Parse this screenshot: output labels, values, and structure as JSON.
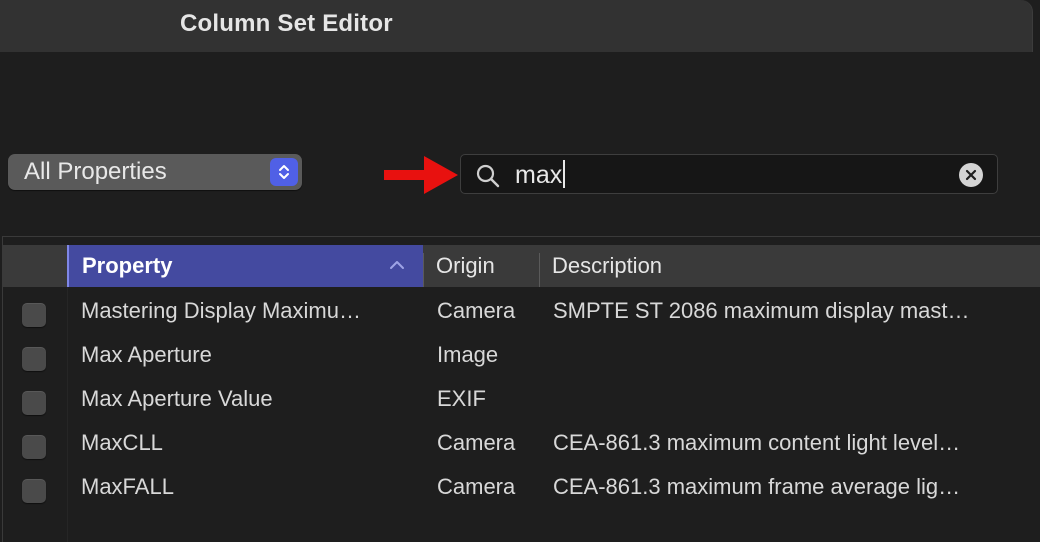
{
  "window": {
    "title": "Column Set Editor"
  },
  "filter": {
    "selected": "All Properties"
  },
  "search": {
    "value": "max",
    "icon": "magnifying-glass"
  },
  "table": {
    "headers": {
      "property": "Property",
      "origin": "Origin",
      "description": "Description"
    },
    "sorted_by": "Property",
    "sort_direction": "ascending",
    "rows": [
      {
        "property": "Mastering Display Maximu…",
        "origin": "Camera",
        "description": "SMPTE ST 2086 maximum display mast…",
        "checked": false
      },
      {
        "property": "Max Aperture",
        "origin": "Image",
        "description": "",
        "checked": false
      },
      {
        "property": "Max Aperture Value",
        "origin": "EXIF",
        "description": "",
        "checked": false
      },
      {
        "property": "MaxCLL",
        "origin": "Camera",
        "description": "CEA-861.3 maximum content light level…",
        "checked": false
      },
      {
        "property": "MaxFALL",
        "origin": "Camera",
        "description": "CEA-861.3 maximum frame average lig…",
        "checked": false
      }
    ]
  },
  "colors": {
    "accent": "#5060e6",
    "selected_header": "#444aa0",
    "annotation_arrow": "#e8110f"
  }
}
